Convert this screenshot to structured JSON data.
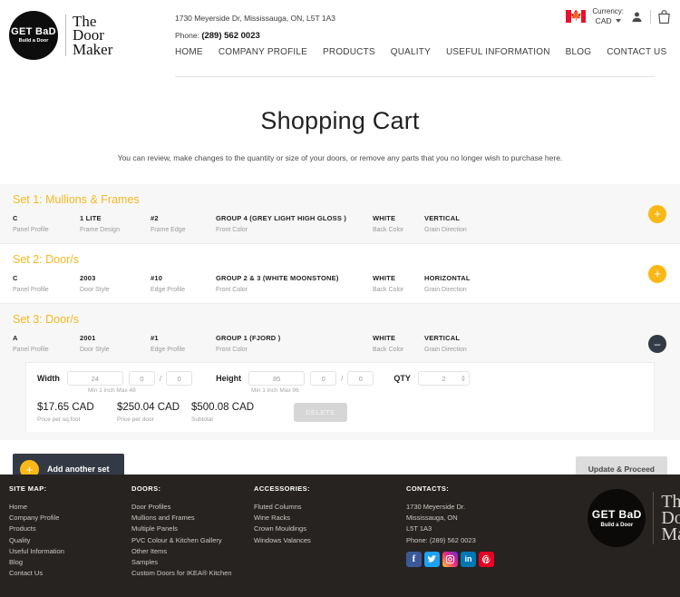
{
  "header": {
    "logo": {
      "badge_line1": "GET BaD",
      "badge_line2": "Build a Door",
      "word1": "The",
      "word2": "Door",
      "word3": "Maker"
    },
    "address": "1730 Meyerside Dr, Mississauga, ON, L5T 1A3",
    "phone_label": "Phone:",
    "phone": "(289) 562 0023",
    "currency_label": "Currency:",
    "currency_value": "CAD",
    "flag_icon": "canada-flag-icon",
    "account_icon": "user-icon",
    "cart_icon": "shopping-bag-icon",
    "nav": [
      {
        "label": "HOME"
      },
      {
        "label": "COMPANY PROFILE"
      },
      {
        "label": "PRODUCTS"
      },
      {
        "label": "QUALITY"
      },
      {
        "label": "USEFUL INFORMATION"
      },
      {
        "label": "BLOG"
      },
      {
        "label": "CONTACT US"
      }
    ]
  },
  "page": {
    "title": "Shopping Cart",
    "subtitle": "You can review, make changes to the quantity or size of your doors, or remove any parts that you no longer wish to purchase here."
  },
  "sets": [
    {
      "title": "Set 1: Mullions & Frames",
      "toggle_icon": "plus-circle-icon",
      "attrs": [
        {
          "value": "C",
          "label": "Panel Profile"
        },
        {
          "value": "1 LITE",
          "label": "Frame Design"
        },
        {
          "value": "#2",
          "label": "Frame Edge"
        },
        {
          "value": "GROUP 4 (GREY LIGHT HIGH GLOSS )",
          "label": "Front Color"
        },
        {
          "value": "WHITE",
          "label": "Back Color"
        },
        {
          "value": "VERTICAL",
          "label": "Grain Direction"
        }
      ]
    },
    {
      "title": "Set 2: Door/s",
      "toggle_icon": "plus-circle-icon",
      "attrs": [
        {
          "value": "C",
          "label": "Panel Profile"
        },
        {
          "value": "2003",
          "label": "Door Style"
        },
        {
          "value": "#10",
          "label": "Edge Profile"
        },
        {
          "value": "GROUP 2 & 3 (WHITE MOONSTONE)",
          "label": "Front Color"
        },
        {
          "value": "WHITE",
          "label": "Back Color"
        },
        {
          "value": "HORIZONTAL",
          "label": "Grain Direction"
        }
      ]
    },
    {
      "title": "Set 3: Door/s",
      "toggle_icon": "minus-circle-icon",
      "attrs": [
        {
          "value": "A",
          "label": "Panel Profile"
        },
        {
          "value": "2001",
          "label": "Door Style"
        },
        {
          "value": "#1",
          "label": "Edge Profile"
        },
        {
          "value": "GROUP 1 (FJORD )",
          "label": "Front Color"
        },
        {
          "value": "WHITE",
          "label": "Back Color"
        },
        {
          "value": "VERTICAL",
          "label": "Grain Direction"
        }
      ]
    }
  ],
  "detail": {
    "width_label": "Width",
    "width_value": "24",
    "width_frac_num": "0",
    "width_frac_den": "0",
    "width_hint": "Min 1 inch Max 48",
    "height_label": "Height",
    "height_value": "85",
    "height_frac_num": "0",
    "height_frac_den": "0",
    "height_hint": "Min 1 inch Max 96",
    "qty_label": "QTY",
    "qty_value": "2",
    "price_sqft": "$17.65 CAD",
    "price_sqft_label": "Price per sq.foot",
    "price_door": "$250.04 CAD",
    "price_door_label": "Price per door",
    "subtotal": "$500.08 CAD",
    "subtotal_label": "Subtotal",
    "delete_label": "DELETE"
  },
  "actions": {
    "add_set_label": "Add another set",
    "add_icon": "plus-icon",
    "proceed_label": "Update & Proceed"
  },
  "footer": {
    "col_sitemap": {
      "heading": "SITE MAP:",
      "items": [
        "Home",
        "Company Profile",
        "Products",
        "Quality",
        "Useful Information",
        "Blog",
        "Contact Us"
      ]
    },
    "col_doors": {
      "heading": "DOORS:",
      "items": [
        "Door Profiles",
        "Mullions and Frames",
        "Multiple Panels",
        "PVC Colour & Kitchen Gallery",
        "Other Items",
        "Samples",
        "Custom Doors for IKEA® Kitchen"
      ]
    },
    "col_accessories": {
      "heading": "ACCESSORIES:",
      "items": [
        "Fluted Columns",
        "Wine Racks",
        "Crown Mouldings",
        "Windows Valances"
      ]
    },
    "col_contacts": {
      "heading": "CONTACTS:",
      "street": "1730 Meyerside Dr.",
      "city": "Mississauga, ON",
      "postal": "L5T 1A3",
      "phone_label": "Phone:",
      "phone": "(289) 562 0023",
      "social": [
        {
          "name": "facebook-icon",
          "glyph": "f"
        },
        {
          "name": "twitter-icon",
          "glyph": "ᵥ"
        },
        {
          "name": "instagram-icon",
          "glyph": "▣"
        },
        {
          "name": "linkedin-icon",
          "glyph": "in"
        },
        {
          "name": "pinterest-icon",
          "glyph": "ⓟ"
        }
      ]
    },
    "logo": {
      "badge_line1": "GET BaD",
      "badge_line2": "Build a Door",
      "word1": "The",
      "word2": "Doo",
      "word3": "Mak"
    }
  },
  "colors": {
    "accent": "#f9b817",
    "dark": "#343a45",
    "footer_bg": "#262321"
  }
}
